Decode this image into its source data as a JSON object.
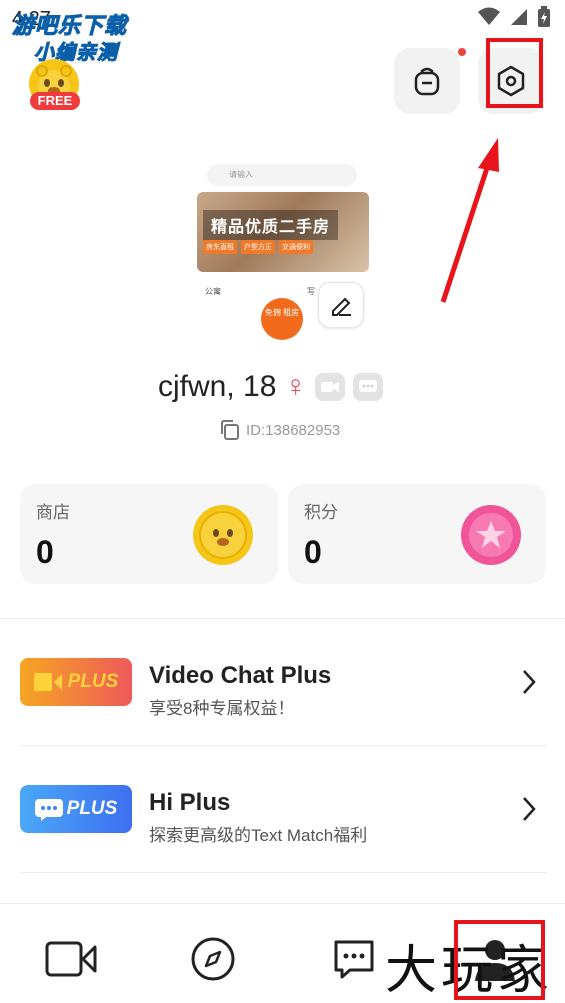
{
  "status_bar": {
    "time": "4:27",
    "watermark_line1": "游吧乐下载",
    "watermark_line2": "小编亲测"
  },
  "header": {
    "free_badge": "FREE",
    "backpack_icon": "backpack-icon",
    "settings_icon": "hexagon-settings-icon"
  },
  "profile": {
    "banner": {
      "search_placeholder": "请输入",
      "title": "精品优质二手房",
      "tags": [
        "房东直租",
        "户型方正",
        "交通便利"
      ],
      "left_label": "公寓",
      "right_label": "写",
      "bubble": "免佣 租房"
    },
    "name_age": "cjfwn, 18",
    "gender_symbol": "♀",
    "id_text": "ID:138682953"
  },
  "stats": [
    {
      "label": "商店",
      "value": "0",
      "icon": "coin-icon"
    },
    {
      "label": "积分",
      "value": "0",
      "icon": "star-points-icon"
    }
  ],
  "plus_items": [
    {
      "badge": "PLUS",
      "title": "Video Chat Plus",
      "subtitle": "享受8种专属权益！"
    },
    {
      "badge": "PLUS",
      "title": "Hi Plus",
      "subtitle": "探索更高级的Text Match福利"
    }
  ],
  "tabbar": {
    "tabs": [
      "video-camera-icon",
      "compass-icon",
      "chat-icon",
      "profile-icon"
    ],
    "watermark": "大玩家"
  },
  "colors": {
    "accent_red": "#e8141b",
    "video_plus_bg": "#f47a4a",
    "hi_plus_bg": "#3d86f0",
    "coin": "#f5c518",
    "points": "#f0559a"
  }
}
